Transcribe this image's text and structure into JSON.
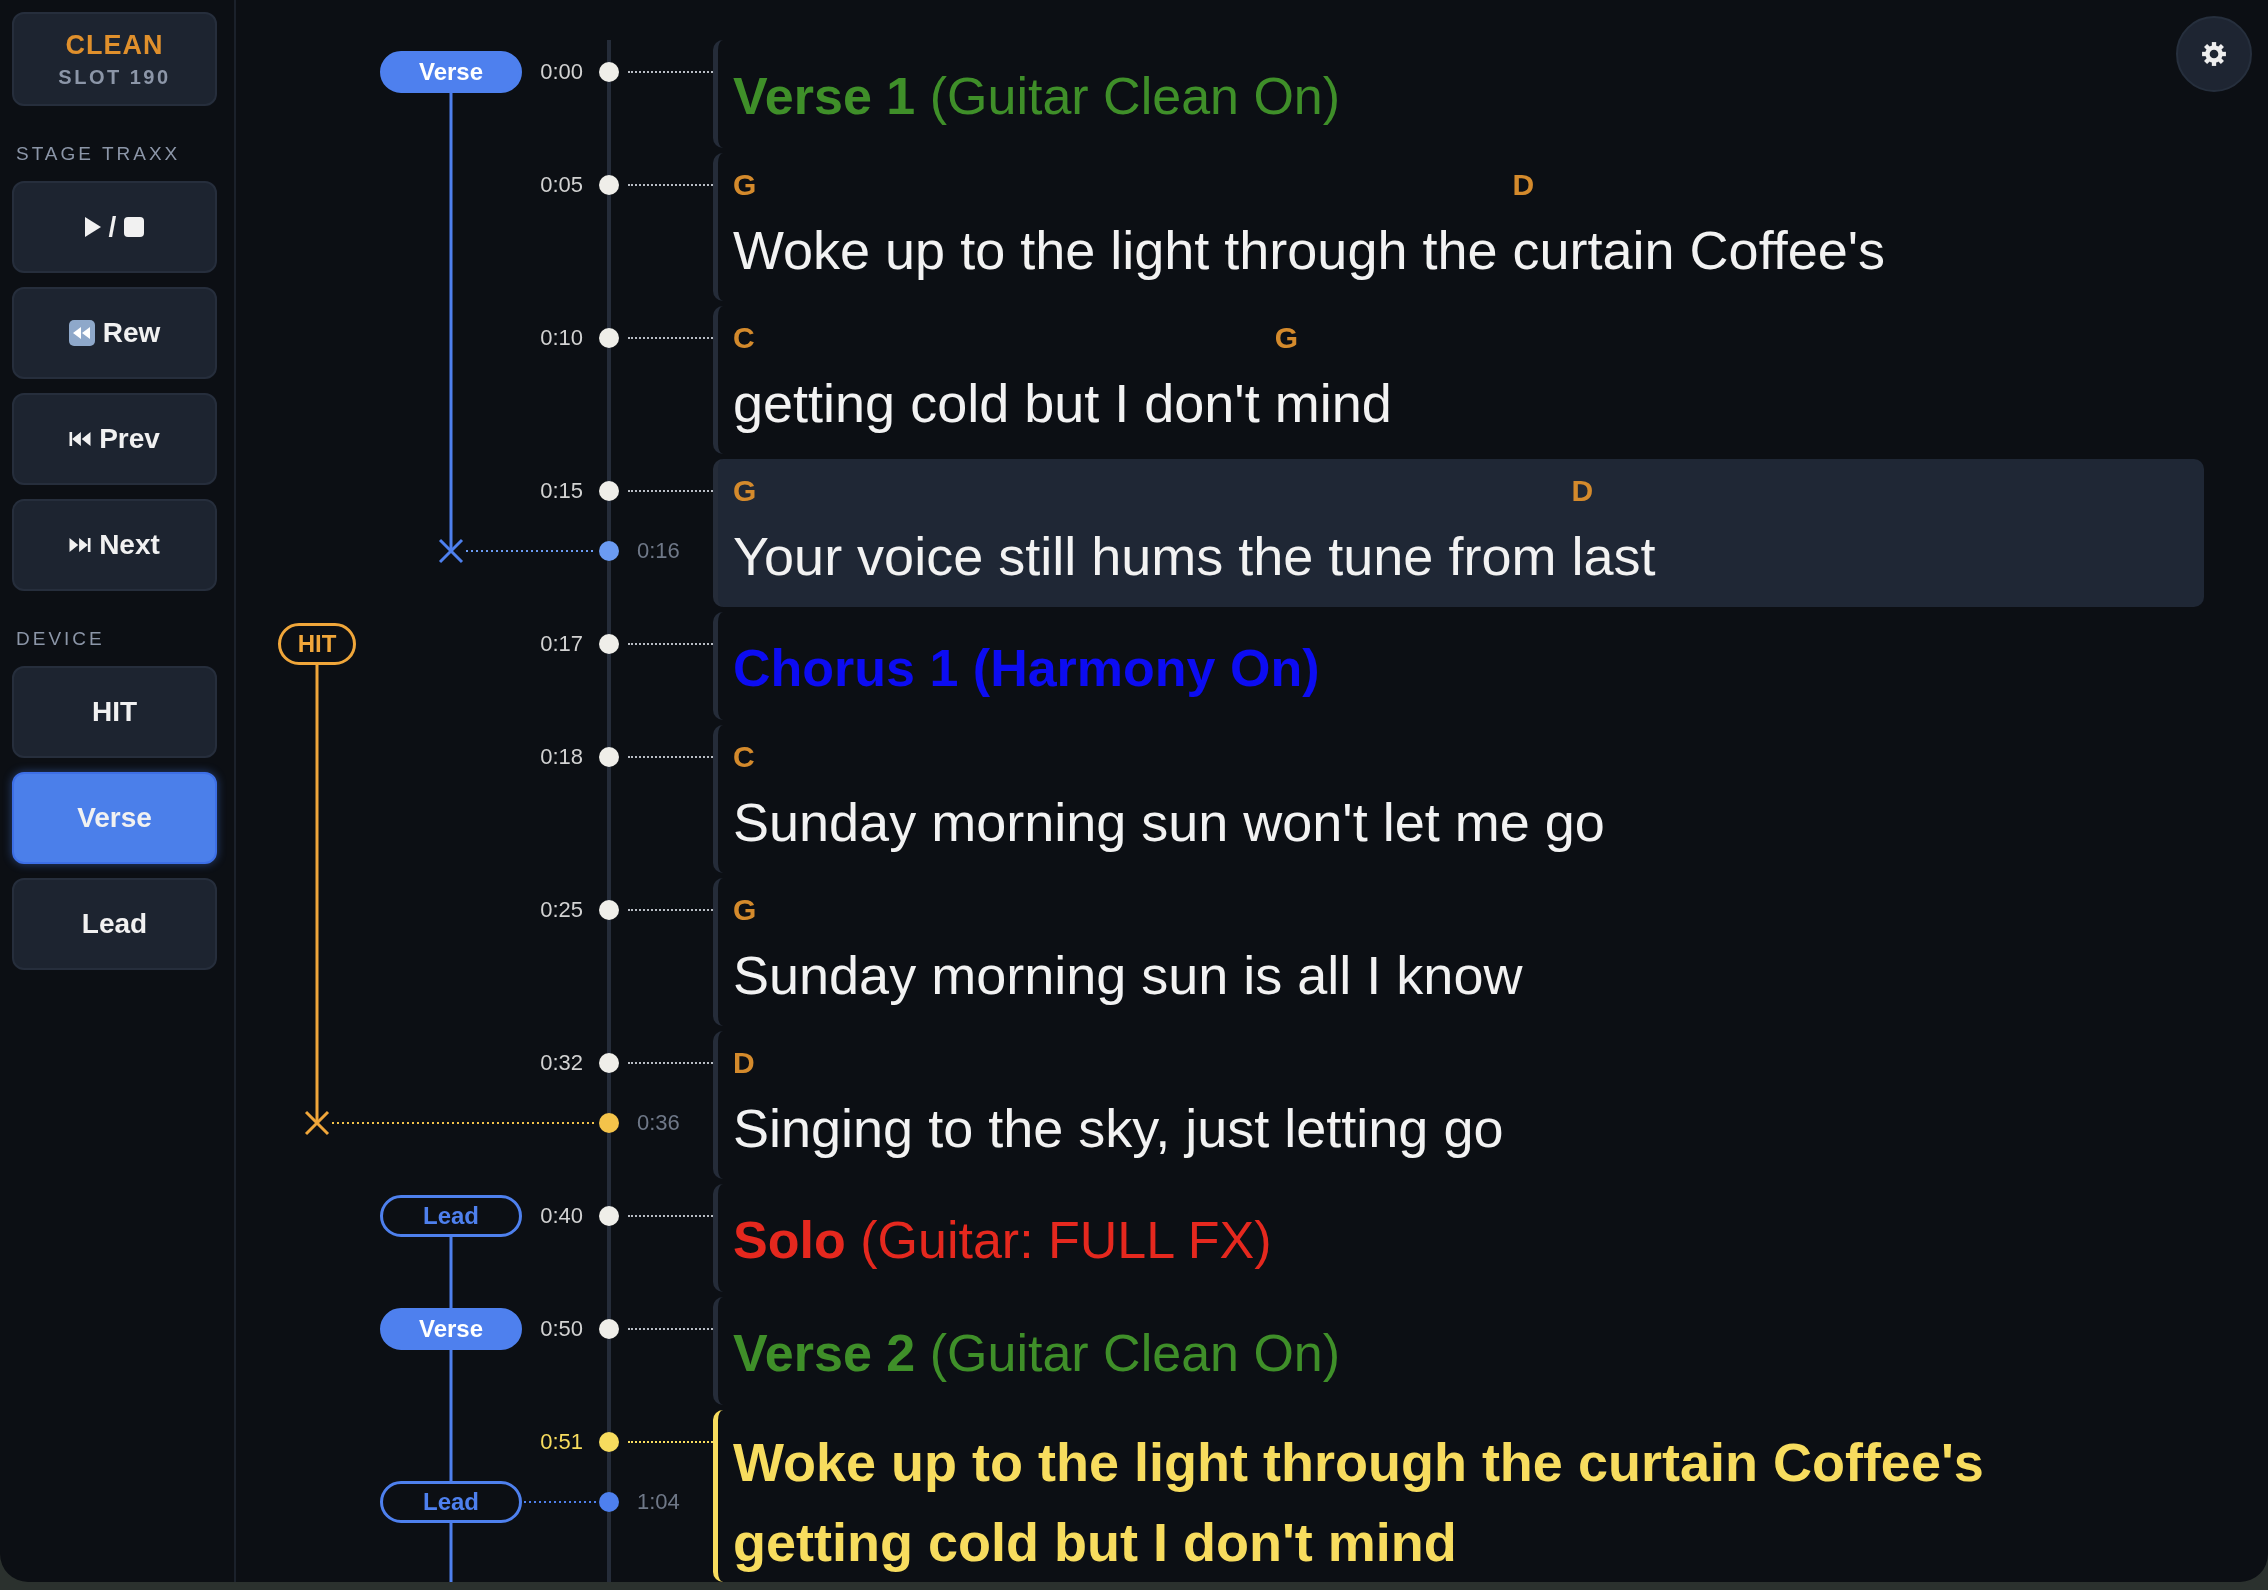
{
  "sidebar": {
    "preset": {
      "name": "CLEAN",
      "slot": "SLOT 190"
    },
    "sections": [
      {
        "title": "STAGE TRAXX",
        "buttons": [
          {
            "kind": "play-stop",
            "label": "/"
          },
          {
            "kind": "rewind",
            "label": "Rew"
          },
          {
            "kind": "previous",
            "label": "Prev"
          },
          {
            "kind": "next",
            "label": "Next"
          }
        ]
      },
      {
        "title": "DEVICE",
        "buttons": [
          {
            "kind": "mode",
            "label": "HIT",
            "selected": false
          },
          {
            "kind": "mode",
            "label": "Verse",
            "selected": true
          },
          {
            "kind": "mode",
            "label": "Lead",
            "selected": false
          }
        ]
      }
    ]
  },
  "timeline": {
    "rows": [
      {
        "kind": "heading",
        "time": "0:00",
        "title": "Verse 1",
        "note": "(Guitar Clean On)",
        "color": "#3f8f29",
        "selected": false,
        "playing": false,
        "cue": {
          "kind": "part",
          "label": "Verse",
          "active": true,
          "color": "#4e80ee"
        }
      },
      {
        "kind": "lyric",
        "time": "0:05",
        "selected": false,
        "playing": false,
        "lines": [
          {
            "segments": [
              {
                "chord": "G",
                "text": "Woke up to the light through the "
              },
              {
                "chord": "D",
                "text": "curtain Coffee's"
              }
            ]
          }
        ]
      },
      {
        "kind": "lyric",
        "time": "0:10",
        "selected": false,
        "playing": false,
        "lines": [
          {
            "segments": [
              {
                "chord": "C",
                "text": "getting cold but I don't "
              },
              {
                "chord": "G",
                "text": "mind"
              }
            ]
          }
        ]
      },
      {
        "kind": "lyric",
        "time": "0:15",
        "selected": true,
        "playing": false,
        "lines": [
          {
            "segments": [
              {
                "chord": "G",
                "text": "Your voice still hums the tune from "
              },
              {
                "chord": "D",
                "text": "last"
              }
            ]
          }
        ],
        "marker": {
          "kind": "stop",
          "time": "0:16",
          "color": "#6b9bf2"
        }
      },
      {
        "kind": "heading",
        "time": "0:17",
        "title": "Chorus 1 (Harmony On)",
        "color": "#0c0cf2",
        "selected": false,
        "playing": false,
        "cue": {
          "kind": "hit",
          "label": "HIT",
          "active": false,
          "color": "#f0a63a"
        }
      },
      {
        "kind": "lyric",
        "time": "0:18",
        "selected": false,
        "playing": false,
        "lines": [
          {
            "segments": [
              {
                "chord": "C",
                "text": "Sunday morning sun won't let me go"
              }
            ]
          }
        ]
      },
      {
        "kind": "lyric",
        "time": "0:25",
        "selected": false,
        "playing": false,
        "lines": [
          {
            "segments": [
              {
                "chord": "G",
                "text": "Sunday morning sun is all I know"
              }
            ]
          }
        ]
      },
      {
        "kind": "lyric",
        "time": "0:32",
        "selected": false,
        "playing": false,
        "lines": [
          {
            "segments": [
              {
                "chord": "D",
                "text": "Singing to the sky, just letting go"
              }
            ]
          }
        ],
        "marker": {
          "kind": "stop",
          "time": "0:36",
          "color": "#f4c34a"
        }
      },
      {
        "kind": "heading",
        "time": "0:40",
        "title": "Solo",
        "note": "(Guitar: FULL FX)",
        "color": "#e5281e",
        "selected": false,
        "playing": false,
        "cue": {
          "kind": "part",
          "label": "Lead",
          "active": false,
          "color": "#4e80ee"
        }
      },
      {
        "kind": "heading",
        "time": "0:50",
        "title": "Verse 2",
        "note": "(Guitar Clean On)",
        "color": "#3f8f29",
        "selected": false,
        "playing": false,
        "cue": {
          "kind": "part",
          "label": "Verse",
          "active": true,
          "color": "#4e80ee"
        }
      },
      {
        "kind": "lyric",
        "time": "0:51",
        "selected": false,
        "playing": true,
        "lines": [
          {
            "segments": [
              {
                "text": "Woke up to the light through the curtain Coffee's"
              }
            ]
          },
          {
            "segments": [
              {
                "text": "getting cold but I don't mind"
              }
            ]
          }
        ],
        "marker": {
          "kind": "cue",
          "time": "1:04",
          "color": "#4e80ee",
          "cue": {
            "kind": "part",
            "label": "Lead",
            "active": false,
            "color": "#4e80ee"
          }
        }
      }
    ]
  }
}
